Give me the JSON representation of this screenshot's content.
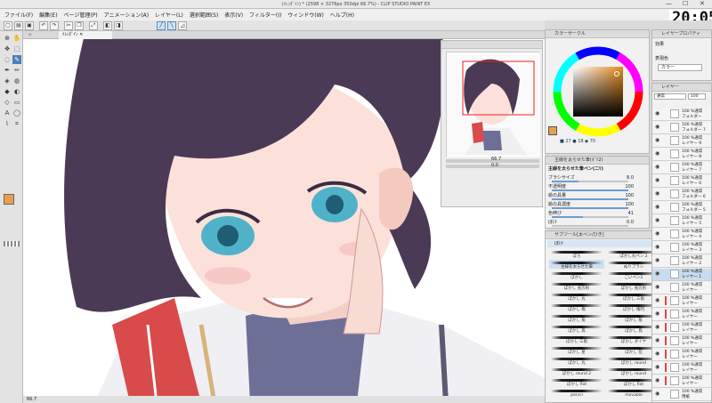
{
  "title": "(ﾒﾚﾝﾀﾞｲﾝ) * (2598 × 3276px 350dpi 66.7%) - CLIP STUDIO PAINT EX",
  "clock": "20:05",
  "window_controls": [
    "—",
    "☐",
    "✕"
  ],
  "menu": [
    "ファイル(F)",
    "編集(E)",
    "ページ管理(P)",
    "アニメーション(A)",
    "レイヤー(L)",
    "選択範囲(S)",
    "表示(V)",
    "フィルター(I)",
    "ウィンドウ(W)",
    "ヘルプ(H)"
  ],
  "canvas_tab": "ﾒﾚﾝﾀﾞｲﾝ",
  "status": {
    "zoom": "66.7"
  },
  "navigator": {
    "zoom": "66.7",
    "angle": "0.0"
  },
  "color": {
    "title": "カラーサークル",
    "readout": "■ 27 ● 18 ◆ 70",
    "main_color": "#e6a14a",
    "sub_color": "#ffffff",
    "accent": "#4e7fb6"
  },
  "props": {
    "header": "主線を太らせた筆(ﾎﾟﾘ2)",
    "tool_name": "主線を太らせた筆ペン(二ﾘ)",
    "rows": [
      {
        "label": "ブラシサイズ",
        "value": "8.0",
        "fill": 0.35
      },
      {
        "label": "不透明度",
        "value": "100",
        "fill": 1.0
      },
      {
        "label": "絵の具量",
        "value": "100",
        "fill": 1.0
      },
      {
        "label": "絵の具濃度",
        "value": "100",
        "fill": 1.0
      },
      {
        "label": "色伸び",
        "value": "41",
        "fill": 0.41
      },
      {
        "label": "ぼけ",
        "value": "0.0",
        "fill": 0.0
      }
    ]
  },
  "brushes": {
    "header": "サブツール[太ペン/ひき]",
    "group": "ぼけ",
    "items": [
      {
        "name": "ぼろ"
      },
      {
        "name": "ぼかし丸ペン 2"
      },
      {
        "name": "主線を太らせた筆",
        "selected": true
      },
      {
        "name": "ぬりブラシ"
      },
      {
        "name": "ぼかし"
      },
      {
        "name": "こいペン2"
      },
      {
        "name": "ぼかし 長方形"
      },
      {
        "name": "ぼかし 長方形"
      },
      {
        "name": "ぼかし 丸"
      },
      {
        "name": "ぼかし 三角"
      },
      {
        "name": "ぼかし 楕"
      },
      {
        "name": "ぼかし 楕円"
      },
      {
        "name": "ぼかし 角"
      },
      {
        "name": "ぼかし 角"
      },
      {
        "name": "ぼかし 鳥"
      },
      {
        "name": "ぼかし 鳥"
      },
      {
        "name": "ぼかし 三角"
      },
      {
        "name": "ぼかし ダイヤ"
      },
      {
        "name": "ぼかし 星"
      },
      {
        "name": "ぼかし 花"
      },
      {
        "name": "ぼかし 丸"
      },
      {
        "name": "ぼかし round"
      },
      {
        "name": "ぼかし round 2"
      },
      {
        "name": "ぼかし round"
      },
      {
        "name": "ぼかし flat"
      },
      {
        "name": "ぼかし flat"
      },
      {
        "name": "pencil"
      },
      {
        "name": "movable"
      }
    ]
  },
  "layer_props": {
    "title": "レイヤープロパティ",
    "effect_label": "効果",
    "color_label": "表現色",
    "color_value": "カラー"
  },
  "layers": {
    "title": "レイヤー",
    "blend": "通常",
    "opacity": "100",
    "items": [
      {
        "pct": "100 %通常",
        "name": "フォルダー"
      },
      {
        "pct": "100 %通常",
        "name": "フォルダー 7"
      },
      {
        "pct": "100 %通常",
        "name": "レイヤー 9"
      },
      {
        "pct": "100 %通常",
        "name": "レイヤー 8"
      },
      {
        "pct": "100 %通常",
        "name": "レイヤー 7"
      },
      {
        "pct": "100 %通常",
        "name": "レイヤー 6"
      },
      {
        "pct": "100 %通常",
        "name": "フォルダー 6"
      },
      {
        "pct": "100 %通常",
        "name": "フォルダー 5"
      },
      {
        "pct": "100 %通常",
        "name": "レイヤー 5"
      },
      {
        "pct": "100 %通常",
        "name": "レイヤー 4"
      },
      {
        "pct": "100 %通常",
        "name": "レイヤー 3"
      },
      {
        "pct": "100 %通常",
        "name": "レイヤー 2"
      },
      {
        "pct": "100 %通常",
        "name": "レイヤー 1",
        "selected": true
      },
      {
        "pct": "100 %通常",
        "name": "レイヤー"
      },
      {
        "pct": "100 %通常",
        "name": "レイヤー"
      },
      {
        "pct": "100 %通常",
        "name": "レイヤー"
      },
      {
        "pct": "100 %通常",
        "name": "レイヤー"
      },
      {
        "pct": "100 %通常",
        "name": "レイヤー"
      },
      {
        "pct": "100 %通常",
        "name": "レイヤー"
      },
      {
        "pct": "100 %通常",
        "name": "レイヤー"
      },
      {
        "pct": "100 %通常",
        "name": "レイヤー"
      },
      {
        "pct": "100 %通常",
        "name": "用紙"
      }
    ]
  }
}
